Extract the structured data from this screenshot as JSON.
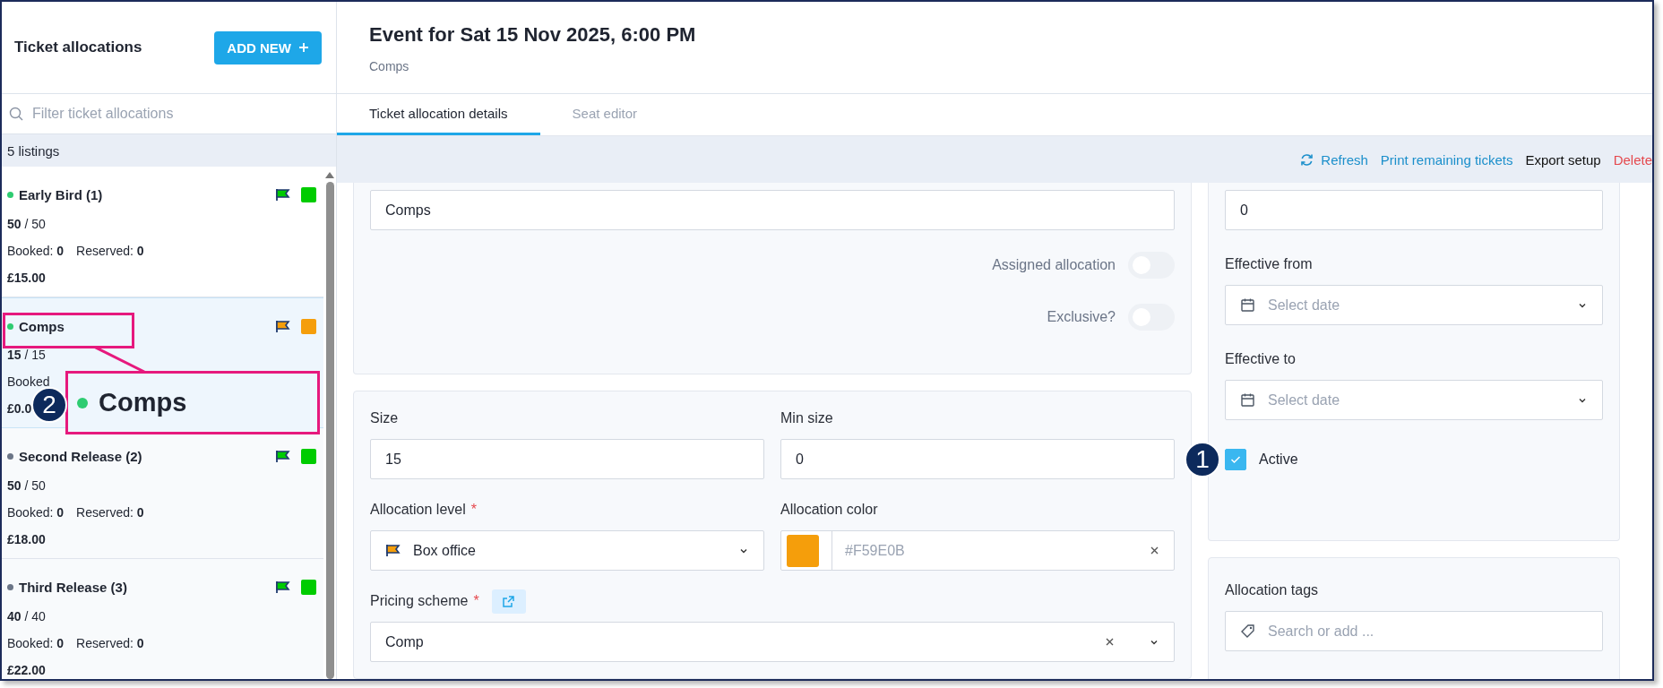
{
  "sidebar": {
    "title": "Ticket allocations",
    "add_button": "ADD NEW",
    "filter_placeholder": "Filter ticket allocations",
    "count": "5 listings",
    "items": [
      {
        "name": "Early Bird (1)",
        "active": true,
        "selected": false,
        "color": "#00cc00",
        "capacity": "**50** / 50",
        "booked": "Booked: **0**",
        "reserved": "Reserved: **0**",
        "price": "£15.00"
      },
      {
        "name": "Comps",
        "active": true,
        "selected": true,
        "color": "#f59e0b",
        "capacity": "**15** / 15",
        "booked": "Booked",
        "price": "£0.0"
      },
      {
        "name": "Second Release (2)",
        "active": false,
        "selected": false,
        "color": "#00cc00",
        "capacity": "**50** / 50",
        "booked": "Booked: **0**",
        "reserved": "Reserved: **0**",
        "price": "£18.00"
      },
      {
        "name": "Third Release (3)",
        "active": false,
        "selected": false,
        "color": "#00cc00",
        "capacity": "**40** / 40",
        "booked": "Booked: **0**",
        "reserved": "Reserved: **0**",
        "price": "£22.00"
      }
    ]
  },
  "header": {
    "title": "Event for Sat 15 Nov 2025, 6:00 PM",
    "subtitle": "Comps"
  },
  "tabs": [
    {
      "label": "Ticket allocation details",
      "selected": true
    },
    {
      "label": "Seat editor",
      "selected": false
    }
  ],
  "toolbar": [
    {
      "label": "Refresh",
      "kind": "refresh"
    },
    {
      "label": "Print remaining tickets",
      "kind": "link"
    },
    {
      "label": "Export setup",
      "kind": "plain"
    },
    {
      "label": "Delete",
      "kind": "danger"
    }
  ],
  "form": {
    "name_field": {
      "value": "Comps"
    },
    "toggles": [
      {
        "label": "Assigned allocation",
        "on": false
      },
      {
        "label": "Exclusive?",
        "on": false
      }
    ],
    "size": {
      "label": "Size",
      "value": "15"
    },
    "min_size": {
      "label": "Min size",
      "value": "0"
    },
    "allocation_level": {
      "label": "Allocation level",
      "required_mark": "*",
      "value": "Box office"
    },
    "allocation_color": {
      "label": "Allocation color",
      "color": "#f59e0b",
      "placeholder": "#F59E0B"
    },
    "pricing_scheme": {
      "label": "Pricing scheme",
      "required_mark": "*",
      "value": "Comp"
    }
  },
  "side_form": {
    "top_field": {
      "value": "0"
    },
    "effective_from": {
      "label": "Effective from",
      "placeholder": "Select date"
    },
    "effective_to": {
      "label": "Effective to",
      "placeholder": "Select date"
    },
    "active": {
      "label": "Active",
      "checked": true
    },
    "tags": {
      "label": "Allocation tags",
      "placeholder": "Search or add ..."
    }
  },
  "annotations": {
    "markers": [
      "1",
      "2"
    ],
    "zoom_label": "Comps"
  }
}
